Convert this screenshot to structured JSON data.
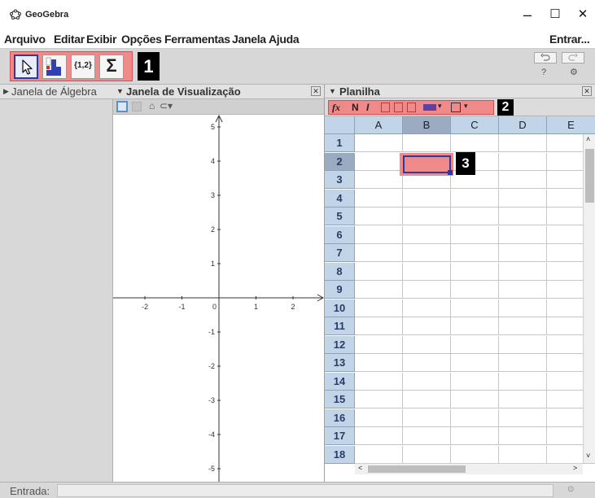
{
  "window": {
    "app_title": "GeoGebra",
    "controls": {
      "minimize": "–",
      "maximize": "☐",
      "close": "✕"
    }
  },
  "menubar": {
    "items": [
      "Arquivo",
      "Editar",
      "Exibir",
      "Opções",
      "Ferramentas",
      "Janela",
      "Ajuda"
    ],
    "login": "Entrar..."
  },
  "toolbar": {
    "tools": [
      {
        "name": "move-tool",
        "icon": "arrow-cursor-icon"
      },
      {
        "name": "spreadsheet-list-tool",
        "icon": "bar-chart-icon"
      },
      {
        "name": "create-list-tool",
        "label": "{1,2}"
      },
      {
        "name": "sum-tool",
        "label": "Σ"
      }
    ],
    "callout_1": "1",
    "undo_icon": "undo-icon",
    "redo_icon": "redo-icon",
    "help_symbol": "?",
    "settings_symbol": "⚙"
  },
  "algebra": {
    "title": "Janela de Álgebra"
  },
  "graphics": {
    "title": "Janela de Visualização",
    "x_ticks": [
      "-2",
      "-1",
      "0",
      "1",
      "2"
    ],
    "y_ticks": [
      "5",
      "4",
      "3",
      "2",
      "1",
      "-1",
      "-2",
      "-3",
      "-4",
      "-5"
    ]
  },
  "spreadsheet": {
    "title": "Planilha",
    "format_buttons": [
      "fx",
      "N",
      "I"
    ],
    "callout_2": "2",
    "callout_3": "3",
    "columns": [
      "A",
      "B",
      "C",
      "D",
      "E"
    ],
    "rows": [
      "1",
      "2",
      "3",
      "4",
      "5",
      "6",
      "7",
      "8",
      "9",
      "10",
      "11",
      "12",
      "13",
      "14",
      "15",
      "16",
      "17",
      "18"
    ],
    "selected_cell": "B2",
    "accent_color": "#f08a8a",
    "selection_border": "#2d3b9c"
  },
  "inputbar": {
    "label": "Entrada:"
  }
}
